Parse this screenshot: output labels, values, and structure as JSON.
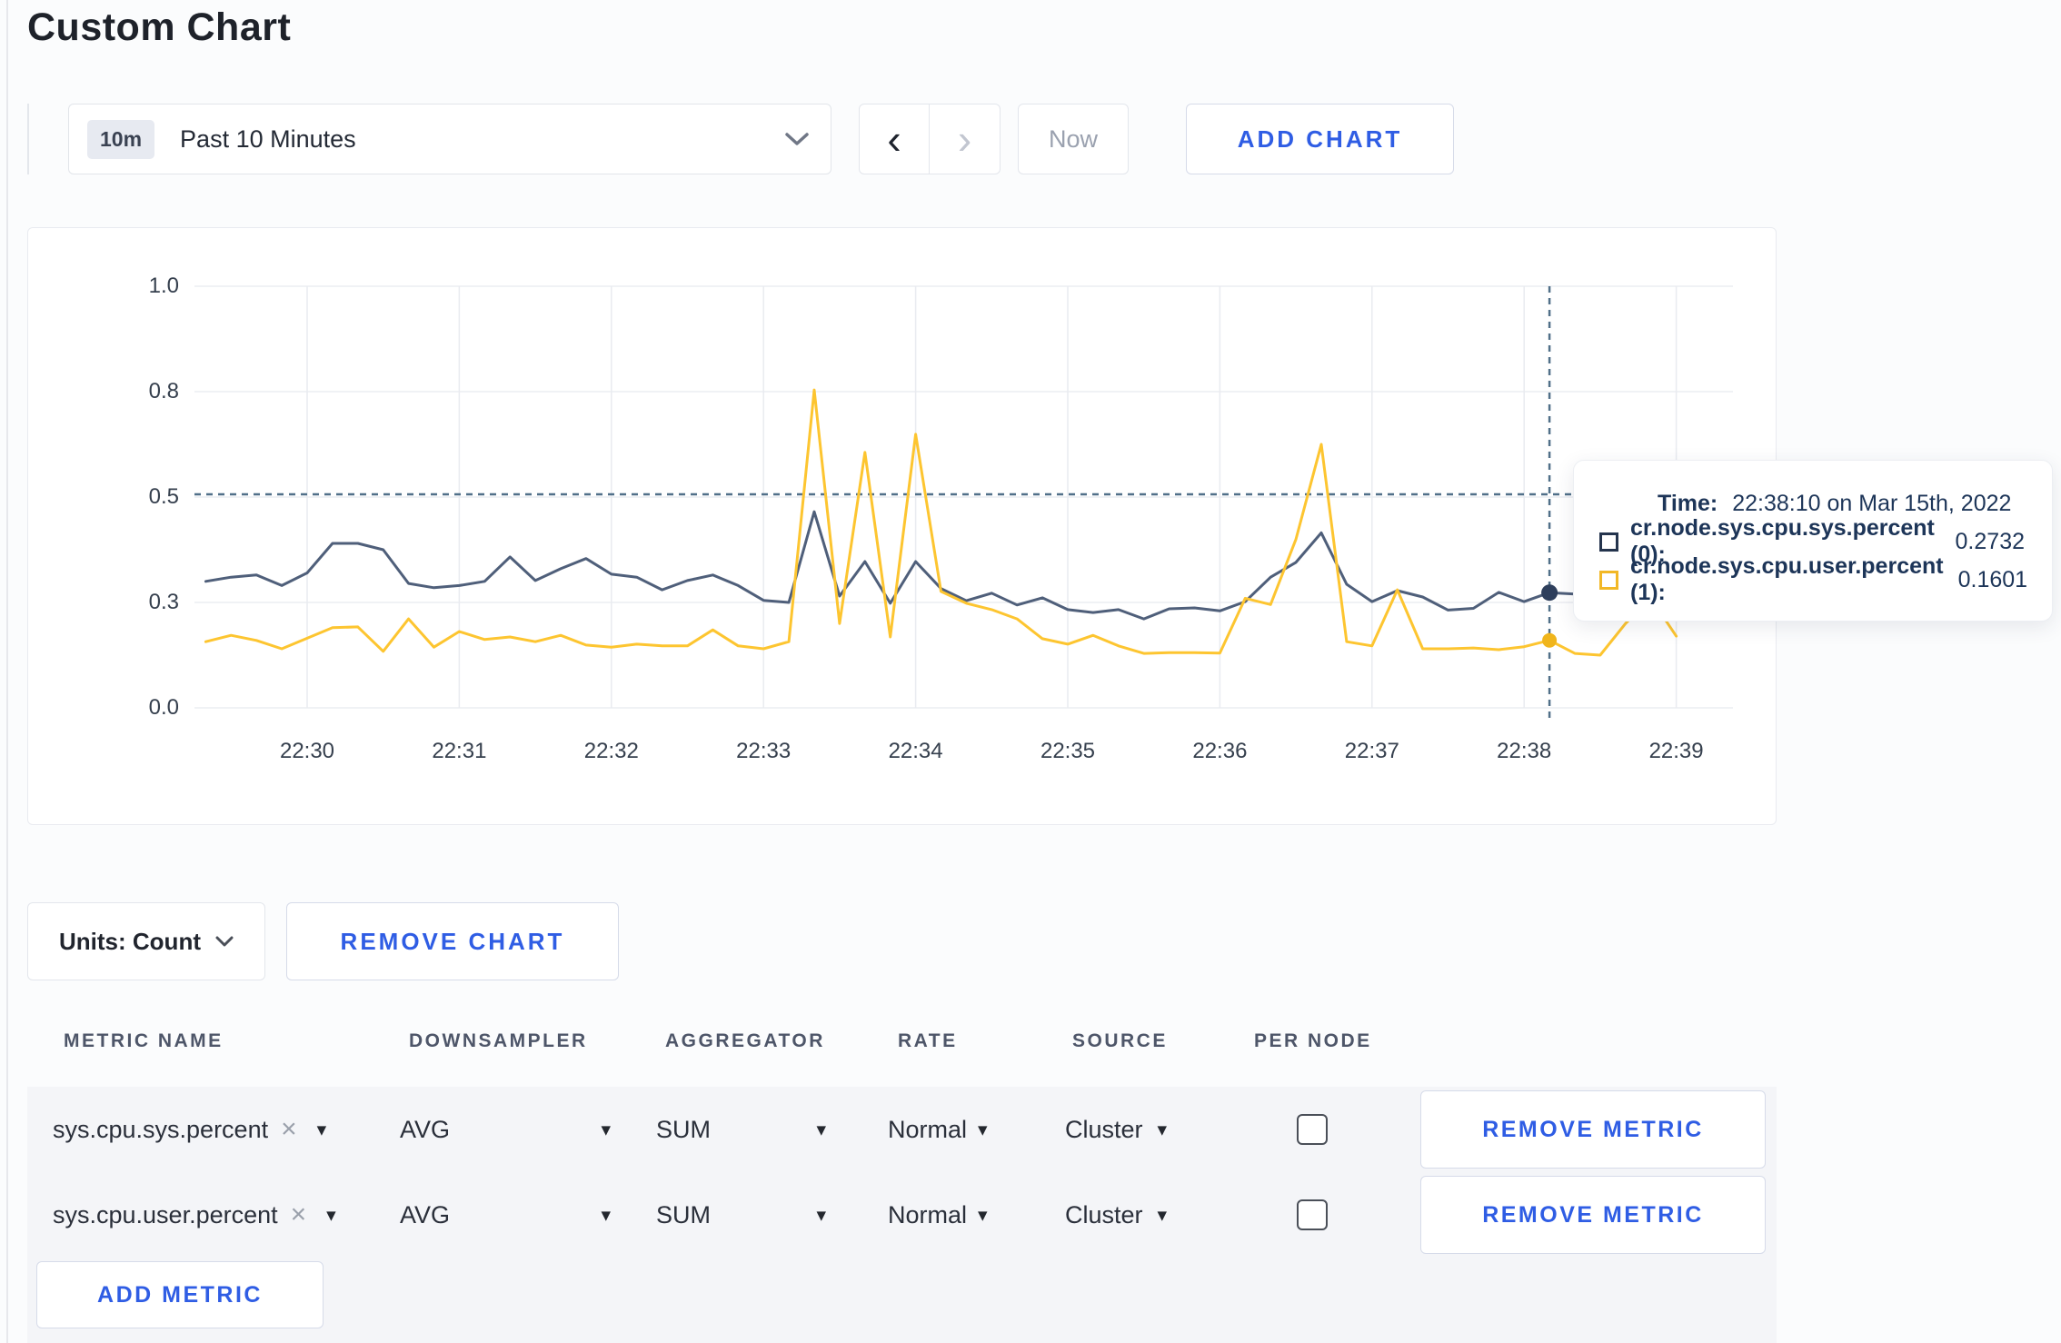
{
  "page": {
    "title": "Custom Chart"
  },
  "icons": {
    "close": "×",
    "caret_down": "▾",
    "chevron_left": "‹",
    "chevron_right": "›"
  },
  "toolbar": {
    "range_badge": "10m",
    "range_label": "Past 10 Minutes",
    "now_label": "Now",
    "add_chart_label": "ADD CHART"
  },
  "chart": {
    "crosshair": {
      "time": "22:38:10",
      "time_index": 53,
      "y_value": 0.5065
    },
    "tooltip": {
      "time_label": "Time:",
      "time_value": "22:38:10 on Mar 15th, 2022",
      "rows": [
        {
          "name": "cr.node.sys.cpu.sys.percent (0):",
          "value": "0.2732"
        },
        {
          "name": "cr.node.sys.cpu.user.percent (1):",
          "value": "0.1601"
        }
      ]
    }
  },
  "chart_data": {
    "type": "line",
    "title": "",
    "xlabel": "",
    "ylabel": "",
    "ylim": [
      0,
      1
    ],
    "grid": true,
    "x_start": "22:29:20",
    "x_step_seconds": 10,
    "x_tick_labels": [
      "22:30",
      "22:31",
      "22:32",
      "22:33",
      "22:34",
      "22:35",
      "22:36",
      "22:37",
      "22:38",
      "22:39"
    ],
    "y_tick_labels": [
      "0.0",
      "0.3",
      "0.5",
      "0.8",
      "1.0"
    ],
    "y_tick_positions": [
      0,
      0.25,
      0.5,
      0.75,
      1.0
    ],
    "series": [
      {
        "name": "cr.node.sys.cpu.sys.percent",
        "color": "#4f5f7a",
        "dot_color": "#2e3f5c",
        "values": [
          0.3,
          0.31,
          0.315,
          0.29,
          0.32,
          0.39,
          0.39,
          0.375,
          0.295,
          0.285,
          0.29,
          0.3,
          0.358,
          0.302,
          0.33,
          0.354,
          0.317,
          0.31,
          0.28,
          0.302,
          0.315,
          0.29,
          0.255,
          0.25,
          0.465,
          0.265,
          0.347,
          0.248,
          0.347,
          0.283,
          0.254,
          0.272,
          0.244,
          0.261,
          0.233,
          0.226,
          0.233,
          0.211,
          0.235,
          0.237,
          0.23,
          0.252,
          0.31,
          0.345,
          0.415,
          0.293,
          0.252,
          0.278,
          0.263,
          0.232,
          0.236,
          0.274,
          0.252,
          0.2732,
          0.27,
          0.278,
          0.265,
          0.275,
          0.285
        ]
      },
      {
        "name": "cr.node.sys.cpu.user.percent",
        "color": "#fdc530",
        "dot_color": "#f0b51c",
        "values": [
          0.157,
          0.172,
          0.16,
          0.14,
          0.165,
          0.19,
          0.192,
          0.134,
          0.211,
          0.144,
          0.181,
          0.162,
          0.168,
          0.157,
          0.172,
          0.149,
          0.144,
          0.151,
          0.147,
          0.147,
          0.185,
          0.147,
          0.14,
          0.157,
          0.754,
          0.2,
          0.606,
          0.168,
          0.649,
          0.276,
          0.248,
          0.233,
          0.211,
          0.164,
          0.151,
          0.172,
          0.147,
          0.129,
          0.131,
          0.131,
          0.13,
          0.26,
          0.245,
          0.4,
          0.625,
          0.157,
          0.147,
          0.28,
          0.14,
          0.14,
          0.142,
          0.138,
          0.145,
          0.1601,
          0.129,
          0.125,
          0.2,
          0.26,
          0.17
        ]
      }
    ],
    "legend_position": "tooltip-only"
  },
  "chart_controls": {
    "units_label": "Units: Count",
    "remove_chart_label": "REMOVE CHART"
  },
  "metrics_table": {
    "headers": [
      "METRIC NAME",
      "DOWNSAMPLER",
      "AGGREGATOR",
      "RATE",
      "SOURCE",
      "PER NODE"
    ],
    "rows": [
      {
        "metric": "sys.cpu.sys.percent",
        "downsampler": "AVG",
        "aggregator": "SUM",
        "rate": "Normal",
        "source": "Cluster",
        "per_node_checked": false,
        "remove_label": "REMOVE METRIC"
      },
      {
        "metric": "sys.cpu.user.percent",
        "downsampler": "AVG",
        "aggregator": "SUM",
        "rate": "Normal",
        "source": "Cluster",
        "per_node_checked": false,
        "remove_label": "REMOVE METRIC"
      }
    ],
    "add_metric_label": "ADD METRIC"
  }
}
